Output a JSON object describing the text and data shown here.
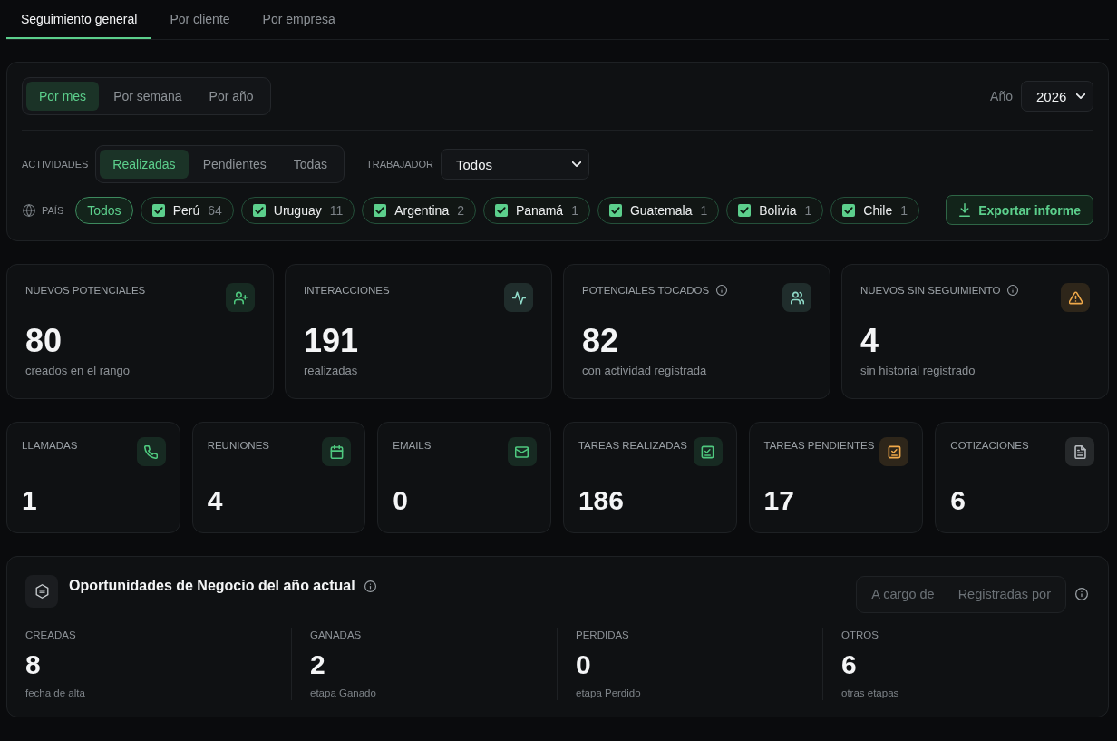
{
  "tabs": [
    {
      "label": "Seguimiento general",
      "selected": true
    },
    {
      "label": "Por cliente",
      "selected": false
    },
    {
      "label": "Por empresa",
      "selected": false
    }
  ],
  "filters": {
    "period_options": [
      {
        "label": "Por mes",
        "selected": true
      },
      {
        "label": "Por semana",
        "selected": false
      },
      {
        "label": "Por año",
        "selected": false
      }
    ],
    "year": {
      "label": "Año",
      "value": "2026"
    },
    "activities": {
      "label": "ACTIVIDADES",
      "options": [
        {
          "label": "Realizadas",
          "selected": true
        },
        {
          "label": "Pendientes",
          "selected": false
        },
        {
          "label": "Todas",
          "selected": false
        }
      ]
    },
    "worker": {
      "label": "TRABAJADOR",
      "value": "Todos"
    },
    "country": {
      "label": "PAÍS",
      "all": {
        "label": "Todos",
        "selected": true
      },
      "options": [
        {
          "name": "Perú",
          "count": "64",
          "checked": true
        },
        {
          "name": "Uruguay",
          "count": "11",
          "checked": true
        },
        {
          "name": "Argentina",
          "count": "2",
          "checked": true
        },
        {
          "name": "Panamá",
          "count": "1",
          "checked": true
        },
        {
          "name": "Guatemala",
          "count": "1",
          "checked": true
        },
        {
          "name": "Bolivia",
          "count": "1",
          "checked": true
        },
        {
          "name": "Chile",
          "count": "1",
          "checked": true
        }
      ]
    },
    "export_button": "Exportar informe"
  },
  "summary_cards": [
    {
      "label": "NUEVOS POTENCIALES",
      "info": false,
      "value": "80",
      "caption": "creados en el rango",
      "color": "#4fc97f"
    },
    {
      "label": "INTERACCIONES",
      "info": false,
      "value": "191",
      "caption": "realizadas",
      "color": "#8fd9c8"
    },
    {
      "label": "POTENCIALES TOCADOS",
      "info": true,
      "value": "82",
      "caption": "con actividad registrada",
      "color": "#8fd9c8"
    },
    {
      "label": "NUEVOS SIN SEGUIMIENTO",
      "info": true,
      "value": "4",
      "caption": "sin historial registrado",
      "color": "#f0a94a"
    }
  ],
  "activity_cards": [
    {
      "label": "LLAMADAS",
      "value": "1",
      "color": "#4fc97f"
    },
    {
      "label": "REUNIONES",
      "value": "4",
      "color": "#4fc97f"
    },
    {
      "label": "EMAILS",
      "value": "0",
      "color": "#4fc97f"
    },
    {
      "label": "TAREAS REALIZADAS",
      "value": "186",
      "color": "#4fc97f"
    },
    {
      "label": "TAREAS PENDIENTES",
      "value": "17",
      "color": "#f0a94a"
    },
    {
      "label": "COTIZACIONES",
      "value": "6",
      "color": "#b9bdc1"
    }
  ],
  "opportunities": {
    "title": "Oportunidades de Negocio del año actual",
    "assignment_options": [
      {
        "label": "A cargo de",
        "selected": false
      },
      {
        "label": "Registradas por",
        "selected": false
      }
    ],
    "stats": [
      {
        "label": "CREADAS",
        "value": "8",
        "caption": "fecha de alta"
      },
      {
        "label": "GANADAS",
        "value": "2",
        "caption": "etapa Ganado"
      },
      {
        "label": "PERDIDAS",
        "value": "0",
        "caption": "etapa Perdido"
      },
      {
        "label": "OTROS",
        "value": "6",
        "caption": "otras etapas"
      }
    ]
  }
}
